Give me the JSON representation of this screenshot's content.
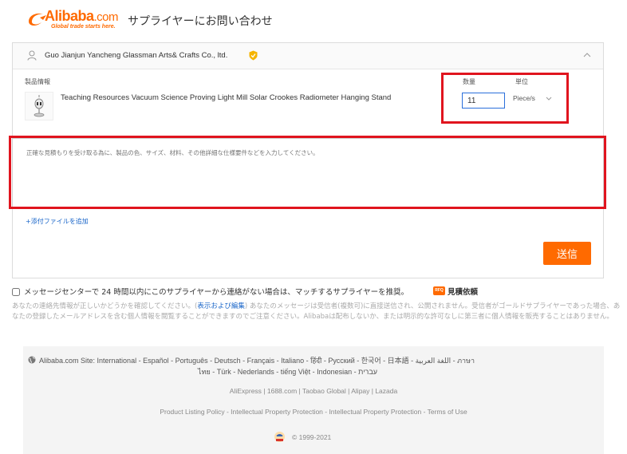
{
  "header": {
    "logo_word": "Alibaba",
    "logo_com": ".com",
    "logo_tagline": "Global trade starts here.",
    "page_title": "サプライヤーにお問い合わせ"
  },
  "supplier": {
    "name": "Guo Jianjun Yancheng Glassman Arts& Crafts Co., ltd."
  },
  "product": {
    "header_label": "製品情報",
    "title": "Teaching Resources Vacuum Science Proving Light Mill Solar Crookes Radiometer Hanging Stand"
  },
  "quantity": {
    "label": "数量",
    "value": "11"
  },
  "unit": {
    "label": "単位",
    "selected": "Piece/s"
  },
  "message": {
    "placeholder": "正確な見積もりを受け取る為に、製品の色、サイズ、材料、その他詳細な仕様要件などを入力してください。"
  },
  "attach": {
    "label": "添付ファイルを追加"
  },
  "send_button": "送信",
  "recommend": {
    "label": "メッセージセンターで 24 時間以内にこのサプライヤーから連絡がない場合は、マッチするサプライヤーを推奨。",
    "rfq_badge": "RFQ",
    "rfq_label": "見積依頼"
  },
  "notice": {
    "part1": "あなたの連絡先情報が正しいかどうかを確認してください。(",
    "link": "表示および編集",
    "part2": ") あなたのメッセージは受信者(複数可)に直接送信され、公開されません。受信者がゴールドサプライヤーであった場合、あなたの登録したメールアドレスを含む個人情報を閲覧することができますのでご注意ください。Alibabaは配布しないか、または明示的な許可なしに第三者に個人情報を販売することはありません。"
  },
  "footer": {
    "sites_line1": "Alibaba.com Site: International - Español - Português - Deutsch - Français - Italiano - हिंदी - Pусский - 한국어 - 日本語 - اللغة العربية - ภาษา",
    "sites_line2": "ไทย - Türk - Nederlands - tiếng Việt - Indonesian - עברית",
    "partners": "AliExpress | 1688.com | Taobao Global | Alipay | Lazada",
    "policies": "Product Listing Policy - Intellectual Property Protection - Intellectual Property Protection - Terms of Use",
    "copyright": "© 1999-2021"
  },
  "colors": {
    "brand": "#ff6a00",
    "link": "#1a66c9",
    "highlight": "#e0141e"
  }
}
